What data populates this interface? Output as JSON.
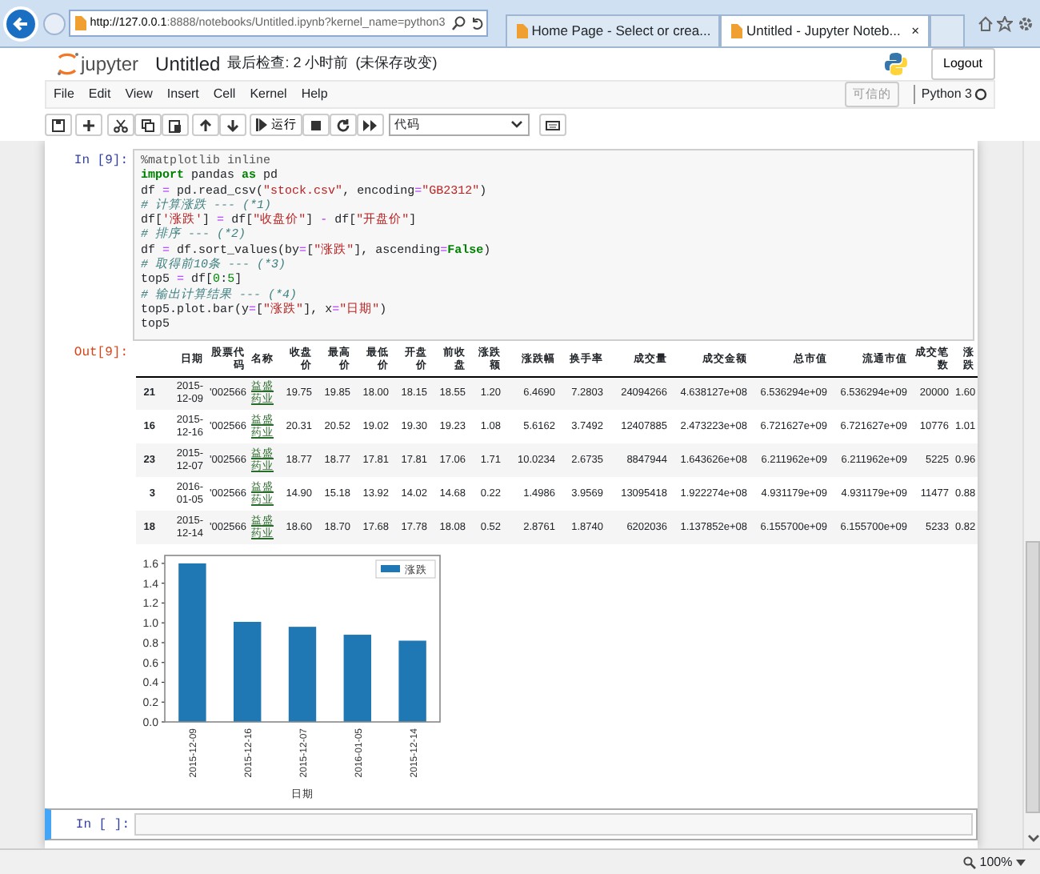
{
  "browser": {
    "url_host": "http://127.0.0.1",
    "url_rest": ":8888/notebooks/Untitled.ipynb?kernel_name=python3",
    "tabs": [
      {
        "label": "Home Page - Select or crea...",
        "selected": false
      },
      {
        "label": "Untitled - Jupyter Noteb...",
        "selected": true
      }
    ],
    "close_tab": "×"
  },
  "header": {
    "logo_text": "jupyter",
    "notebook_name": "Untitled",
    "checkpoint": "最后检查: 2 小时前",
    "unsaved": "(未保存改变)",
    "logout": "Logout"
  },
  "menu": [
    "File",
    "Edit",
    "View",
    "Insert",
    "Cell",
    "Kernel",
    "Help"
  ],
  "trusted": {
    "label": "可信的",
    "disabled": true
  },
  "kernel": {
    "name": "Python 3",
    "busy": false
  },
  "toolbar": {
    "run": "运行",
    "cell_type": "代码"
  },
  "cells": [
    {
      "prompt": "In [9]:",
      "selected": false,
      "code_lines": [
        [
          {
            "text": "%matplotlib inline",
            "kind": "magic"
          }
        ],
        [
          {
            "text": "import",
            "kind": "kw"
          },
          {
            "text": " pandas ",
            "kind": "plain"
          },
          {
            "text": "as",
            "kind": "kw"
          },
          {
            "text": " pd",
            "kind": "plain"
          }
        ],
        [
          {
            "text": "df ",
            "kind": "plain"
          },
          {
            "text": "=",
            "kind": "op"
          },
          {
            "text": " pd.read_csv(",
            "kind": "plain"
          },
          {
            "text": "\"stock.csv\"",
            "kind": "str"
          },
          {
            "text": ", encoding",
            "kind": "plain"
          },
          {
            "text": "=",
            "kind": "op"
          },
          {
            "text": "\"GB2312\"",
            "kind": "str"
          },
          {
            "text": ")",
            "kind": "plain"
          }
        ],
        [
          {
            "text": "# 计算涨跌 --- (*1)",
            "kind": "cmt"
          }
        ],
        [
          {
            "text": "df[",
            "kind": "plain"
          },
          {
            "text": "'涨跌'",
            "kind": "str"
          },
          {
            "text": "] ",
            "kind": "plain"
          },
          {
            "text": "=",
            "kind": "op"
          },
          {
            "text": " df[",
            "kind": "plain"
          },
          {
            "text": "\"收盘价\"",
            "kind": "str"
          },
          {
            "text": "] ",
            "kind": "plain"
          },
          {
            "text": "-",
            "kind": "op"
          },
          {
            "text": " df[",
            "kind": "plain"
          },
          {
            "text": "\"开盘价\"",
            "kind": "str"
          },
          {
            "text": "]",
            "kind": "plain"
          }
        ],
        [
          {
            "text": "# 排序 --- (*2)",
            "kind": "cmt"
          }
        ],
        [
          {
            "text": "df ",
            "kind": "plain"
          },
          {
            "text": "=",
            "kind": "op"
          },
          {
            "text": " df.sort_values(by",
            "kind": "plain"
          },
          {
            "text": "=",
            "kind": "op"
          },
          {
            "text": "[",
            "kind": "plain"
          },
          {
            "text": "\"涨跌\"",
            "kind": "str"
          },
          {
            "text": "], ascending",
            "kind": "plain"
          },
          {
            "text": "=",
            "kind": "op"
          },
          {
            "text": "False",
            "kind": "kw"
          },
          {
            "text": ")",
            "kind": "plain"
          }
        ],
        [
          {
            "text": "# 取得前10条 --- (*3)",
            "kind": "cmt"
          }
        ],
        [
          {
            "text": "top5 ",
            "kind": "plain"
          },
          {
            "text": "=",
            "kind": "op"
          },
          {
            "text": " df[",
            "kind": "plain"
          },
          {
            "text": "0",
            "kind": "num"
          },
          {
            "text": ":",
            "kind": "plain"
          },
          {
            "text": "5",
            "kind": "num"
          },
          {
            "text": "]",
            "kind": "plain"
          }
        ],
        [
          {
            "text": "# 输出计算结果 --- (*4)",
            "kind": "cmt"
          }
        ],
        [
          {
            "text": "top5.plot.bar(y",
            "kind": "plain"
          },
          {
            "text": "=",
            "kind": "op"
          },
          {
            "text": "[",
            "kind": "plain"
          },
          {
            "text": "\"涨跌\"",
            "kind": "str"
          },
          {
            "text": "], x",
            "kind": "plain"
          },
          {
            "text": "=",
            "kind": "op"
          },
          {
            "text": "\"日期\"",
            "kind": "str"
          },
          {
            "text": ")",
            "kind": "plain"
          }
        ],
        [
          {
            "text": "top5",
            "kind": "plain"
          }
        ]
      ],
      "output": {
        "prompt": "Out[9]:",
        "table": {
          "columns": [
            "",
            "日期",
            "股票代码",
            "名称",
            "收盘价",
            "最高价",
            "最低价",
            "开盘价",
            "前收盘",
            "涨跌额",
            "涨跌幅",
            "换手率",
            "成交量",
            "成交金额",
            "总市值",
            "流通市值",
            "成交笔数",
            "涨跌"
          ],
          "rows": [
            [
              "21",
              "2015-12-09",
              "'002566",
              "益盛药业",
              "19.75",
              "19.85",
              "18.00",
              "18.15",
              "18.55",
              "1.20",
              "6.4690",
              "7.2803",
              "24094266",
              "4.638127e+08",
              "6.536294e+09",
              "6.536294e+09",
              "20000",
              "1.60"
            ],
            [
              "16",
              "2015-12-16",
              "'002566",
              "益盛药业",
              "20.31",
              "20.52",
              "19.02",
              "19.30",
              "19.23",
              "1.08",
              "5.6162",
              "3.7492",
              "12407885",
              "2.473223e+08",
              "6.721627e+09",
              "6.721627e+09",
              "10776",
              "1.01"
            ],
            [
              "23",
              "2015-12-07",
              "'002566",
              "益盛药业",
              "18.77",
              "18.77",
              "17.81",
              "17.81",
              "17.06",
              "1.71",
              "10.0234",
              "2.6735",
              "8847944",
              "1.643626e+08",
              "6.211962e+09",
              "6.211962e+09",
              "5225",
              "0.96"
            ],
            [
              "3",
              "2016-01-05",
              "'002566",
              "益盛药业",
              "14.90",
              "15.18",
              "13.92",
              "14.02",
              "14.68",
              "0.22",
              "1.4986",
              "3.9569",
              "13095418",
              "1.922274e+08",
              "4.931179e+09",
              "4.931179e+09",
              "11477",
              "0.88"
            ],
            [
              "18",
              "2015-12-14",
              "'002566",
              "益盛药业",
              "18.60",
              "18.70",
              "17.68",
              "17.78",
              "18.08",
              "0.52",
              "2.8761",
              "1.8740",
              "6202036",
              "1.137852e+08",
              "6.155700e+09",
              "6.155700e+09",
              "5233",
              "0.82"
            ]
          ]
        },
        "chart_data": {
          "type": "bar",
          "xlabel": "日期",
          "categories": [
            "2015-12-09",
            "2015-12-16",
            "2015-12-07",
            "2016-01-05",
            "2015-12-14"
          ],
          "series": [
            {
              "name": "涨跌",
              "color": "#1f77b4",
              "values": [
                1.6,
                1.01,
                0.96,
                0.88,
                0.82
              ]
            }
          ],
          "ylim": [
            0,
            1.68
          ],
          "yticks": [
            {
              "value": 0,
              "label": "0.0"
            },
            {
              "value": 0.2,
              "label": "0.2"
            },
            {
              "value": 0.4,
              "label": "0.4"
            },
            {
              "value": 0.6,
              "label": "0.6"
            },
            {
              "value": 0.8,
              "label": "0.8"
            },
            {
              "value": 1.0,
              "label": "1.0"
            },
            {
              "value": 1.2,
              "label": "1.2"
            },
            {
              "value": 1.4,
              "label": "1.4"
            },
            {
              "value": 1.6,
              "label": "1.6"
            }
          ]
        }
      }
    },
    {
      "prompt": "In [ ]:",
      "selected": true
    }
  ],
  "status_bar": {
    "zoom": "100%"
  }
}
